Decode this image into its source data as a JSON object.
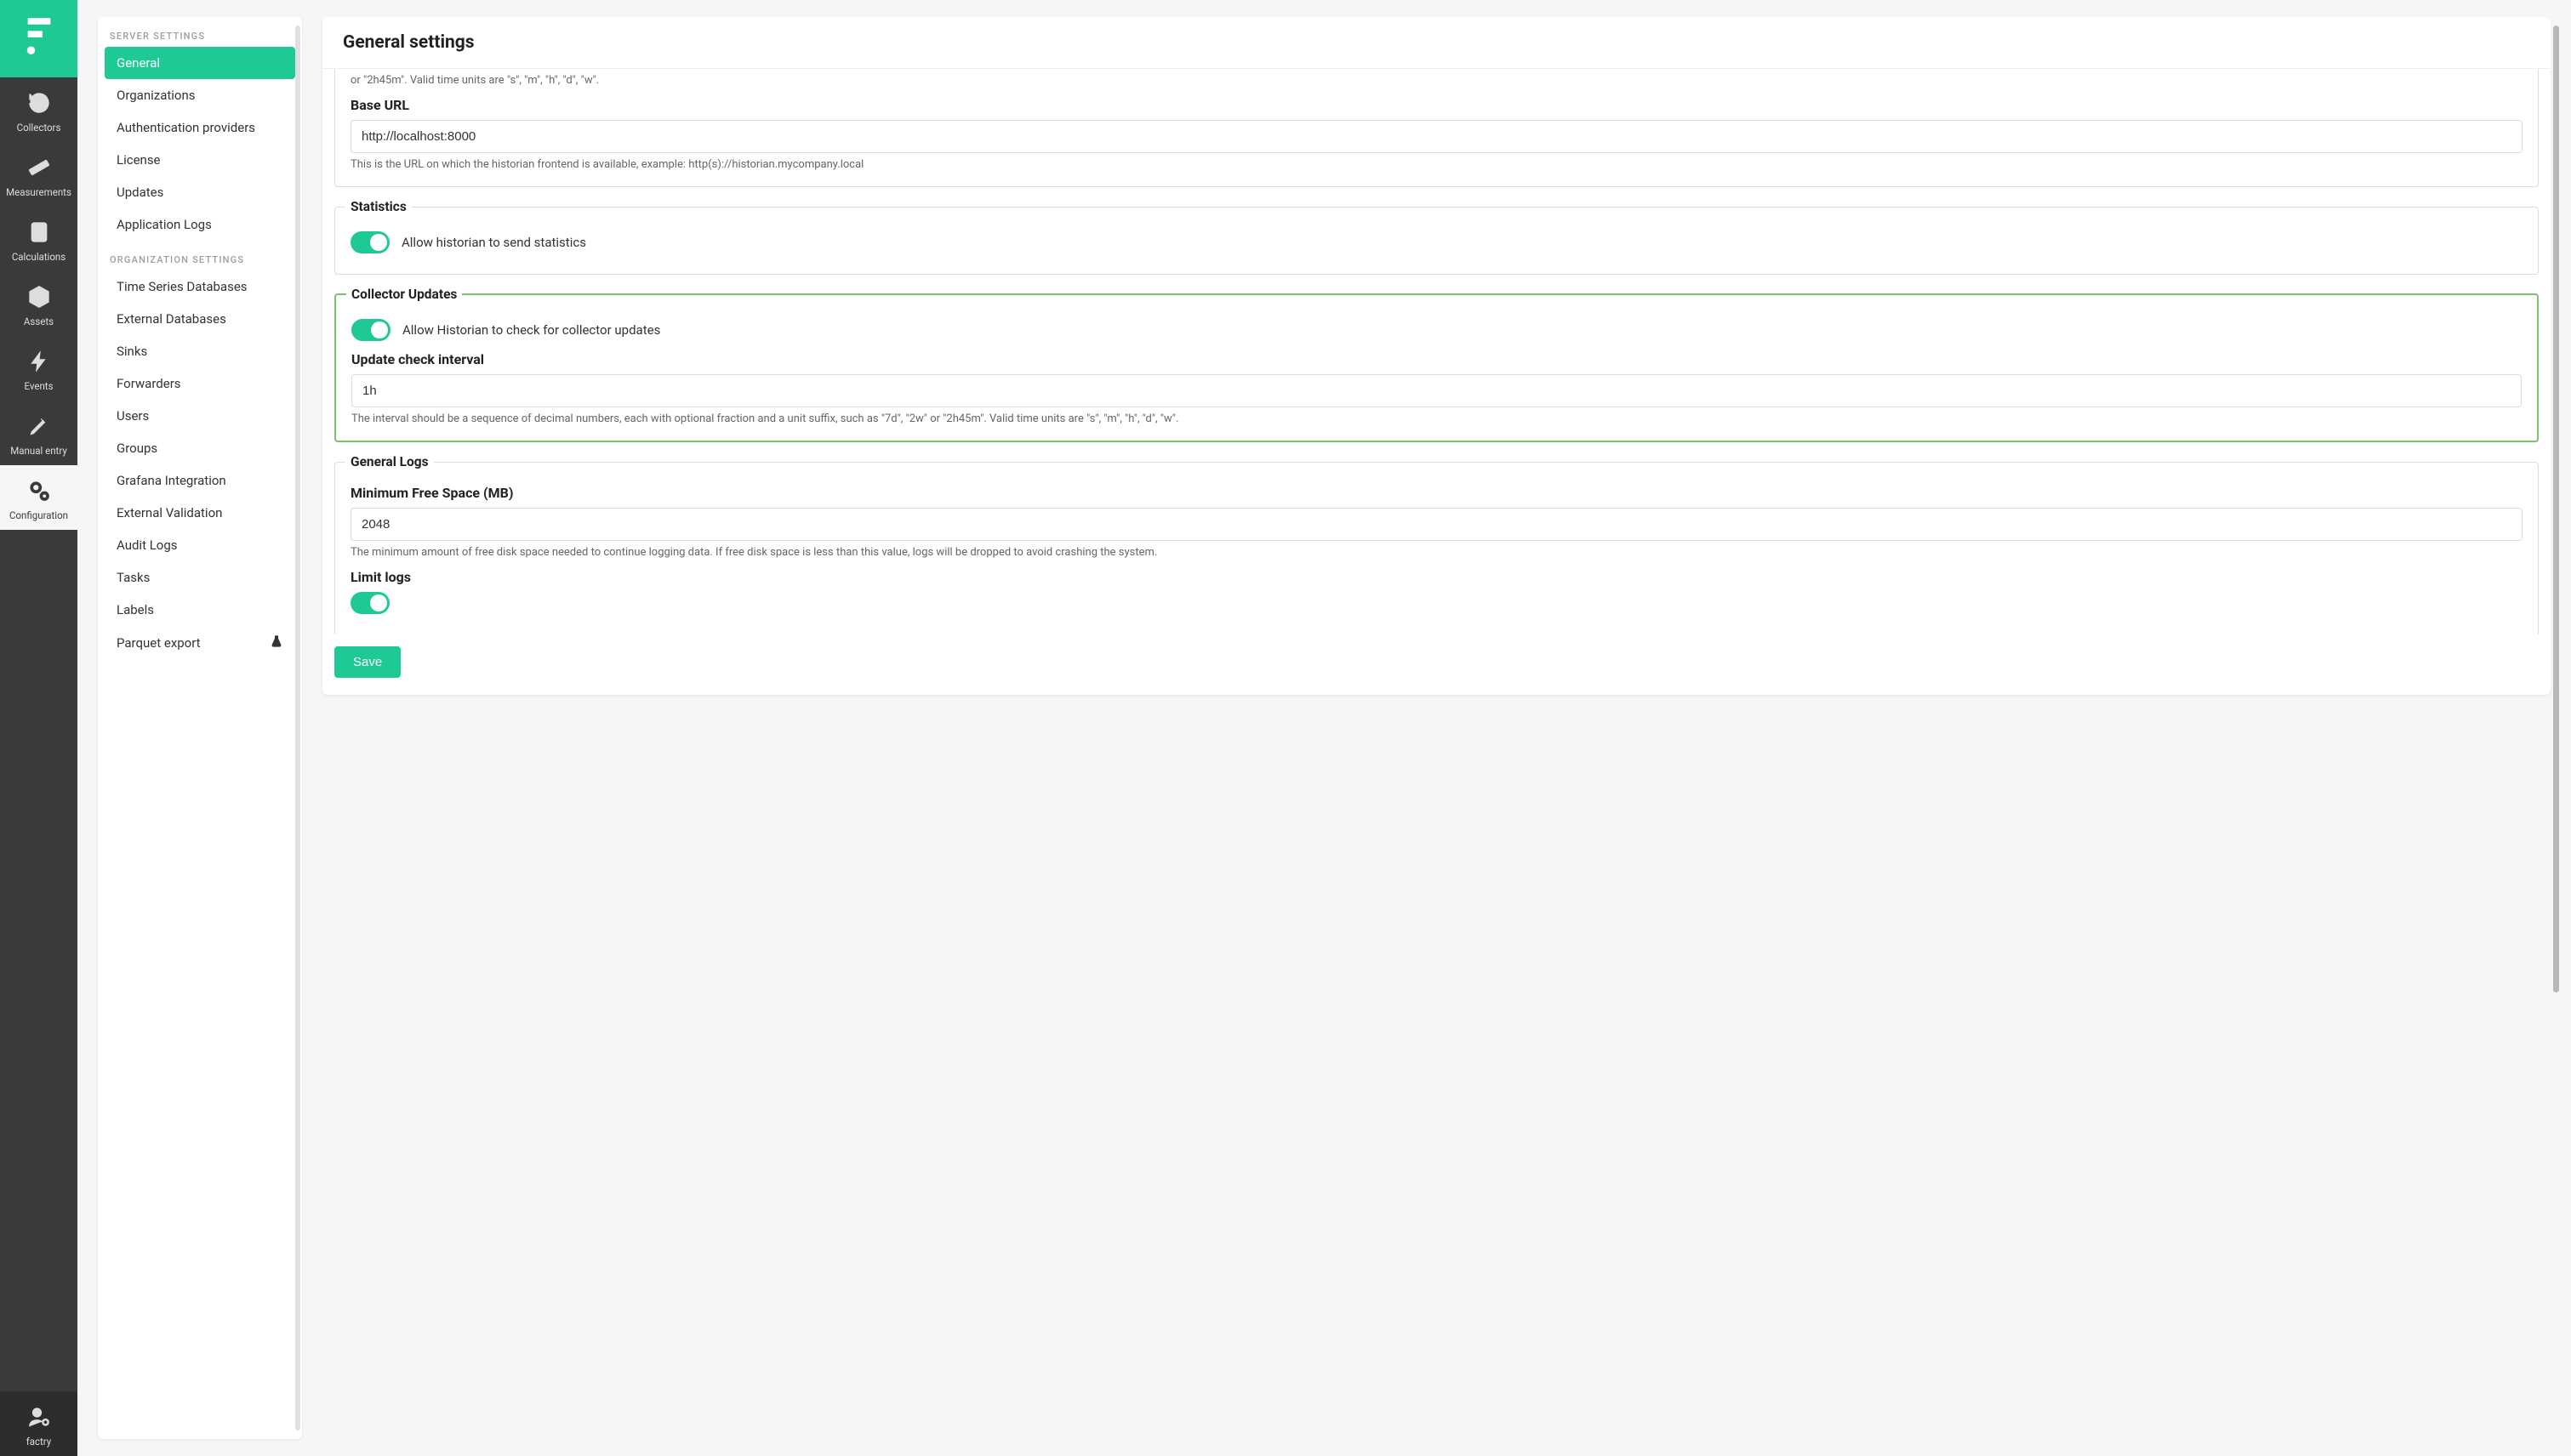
{
  "nav": {
    "items": [
      {
        "name": "collectors",
        "label": "Collectors"
      },
      {
        "name": "measurements",
        "label": "Measurements"
      },
      {
        "name": "calculations",
        "label": "Calculations"
      },
      {
        "name": "assets",
        "label": "Assets"
      },
      {
        "name": "events",
        "label": "Events"
      },
      {
        "name": "manual-entry",
        "label": "Manual entry"
      },
      {
        "name": "configuration",
        "label": "Configuration"
      },
      {
        "name": "factry",
        "label": "factry"
      }
    ]
  },
  "sidebar": {
    "groups": {
      "server": {
        "title": "SERVER SETTINGS",
        "items": [
          {
            "label": "General"
          },
          {
            "label": "Organizations"
          },
          {
            "label": "Authentication providers"
          },
          {
            "label": "License"
          },
          {
            "label": "Updates"
          },
          {
            "label": "Application Logs"
          }
        ]
      },
      "org": {
        "title": "ORGANIZATION SETTINGS",
        "items": [
          {
            "label": "Time Series Databases"
          },
          {
            "label": "External Databases"
          },
          {
            "label": "Sinks"
          },
          {
            "label": "Forwarders"
          },
          {
            "label": "Users"
          },
          {
            "label": "Groups"
          },
          {
            "label": "Grafana Integration"
          },
          {
            "label": "External Validation"
          },
          {
            "label": "Audit Logs"
          },
          {
            "label": "Tasks"
          },
          {
            "label": "Labels"
          },
          {
            "label": "Parquet export"
          }
        ]
      }
    }
  },
  "page": {
    "title": "General settings",
    "partial_help": "or \"2h45m\". Valid time units are \"s\", \"m\", \"h\", \"d\", \"w\".",
    "base_url": {
      "label": "Base URL",
      "value": "http://localhost:8000",
      "help": "This is the URL on which the historian frontend is available, example: http(s)://historian.mycompany.local"
    },
    "statistics": {
      "legend": "Statistics",
      "allow_label": "Allow historian to send statistics"
    },
    "collector_updates": {
      "legend": "Collector Updates",
      "allow_label": "Allow Historian to check for collector updates",
      "interval_label": "Update check interval",
      "interval_value": "1h",
      "interval_help": "The interval should be a sequence of decimal numbers, each with optional fraction and a unit suffix, such as \"7d\", \"2w\" or \"2h45m\". Valid time units are \"s\", \"m\", \"h\", \"d\", \"w\"."
    },
    "general_logs": {
      "legend": "General Logs",
      "min_free_label": "Minimum Free Space (MB)",
      "min_free_value": "2048",
      "min_free_help": "The minimum amount of free disk space needed to continue logging data. If free disk space is less than this value, logs will be dropped to avoid crashing the system.",
      "limit_label": "Limit logs"
    },
    "save_label": "Save"
  }
}
